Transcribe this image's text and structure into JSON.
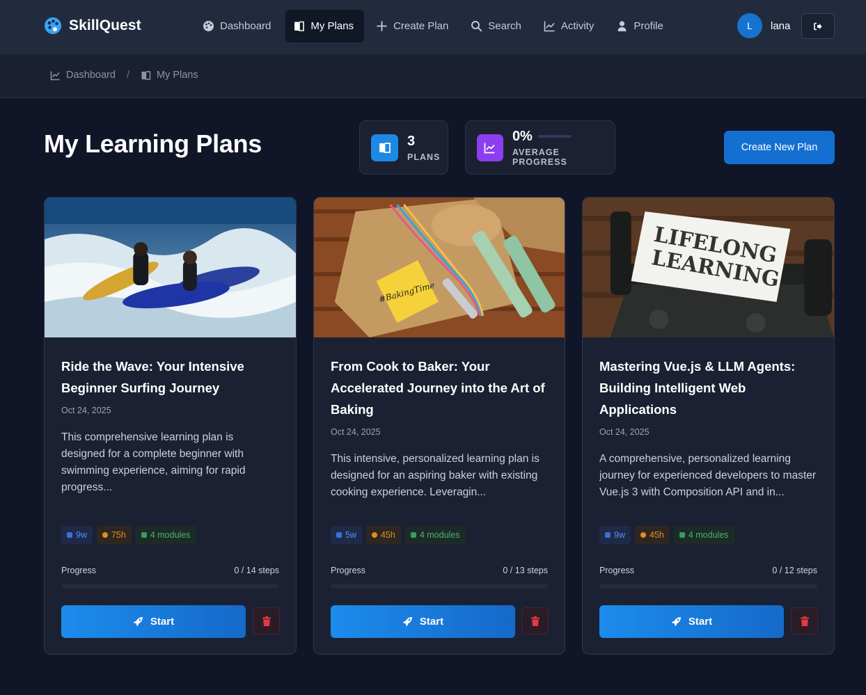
{
  "app": {
    "name": "SkillQuest"
  },
  "nav": {
    "items": [
      {
        "label": "Dashboard",
        "icon": "palette-icon",
        "active": false
      },
      {
        "label": "My Plans",
        "icon": "book-icon",
        "active": true
      },
      {
        "label": "Create Plan",
        "icon": "plus-icon",
        "active": false
      },
      {
        "label": "Search",
        "icon": "search-icon",
        "active": false
      },
      {
        "label": "Activity",
        "icon": "chart-line-icon",
        "active": false
      },
      {
        "label": "Profile",
        "icon": "user-icon",
        "active": false
      }
    ]
  },
  "user": {
    "initial": "L",
    "name": "lana"
  },
  "breadcrumb": {
    "items": [
      "Dashboard",
      "My Plans"
    ],
    "separator": "/"
  },
  "page": {
    "title": "My Learning Plans"
  },
  "stats": {
    "plans": {
      "value": "3",
      "label": "PLANS"
    },
    "progress": {
      "value": "0%",
      "label": "AVERAGE PROGRESS",
      "fraction": 0
    }
  },
  "actions": {
    "create_label": "Create New Plan"
  },
  "cards": [
    {
      "image": "surfers-in-waves",
      "title": "Ride the Wave: Your Intensive Beginner Surfing Journey",
      "date": "Oct 24, 2025",
      "description": "This comprehensive learning plan is designed for a complete beginner with swimming experience, aiming for rapid progress...",
      "tags": {
        "weeks": "9w",
        "hours": "75h",
        "modules": "4 modules"
      },
      "progress_label": "Progress",
      "progress_steps": "0 / 14 steps",
      "progress_fraction": 0,
      "start_label": "Start"
    },
    {
      "image": "baking-tools-on-cutting-board",
      "title": "From Cook to Baker: Your Accelerated Journey into the Art of Baking",
      "date": "Oct 24, 2025",
      "description": "This intensive, personalized learning plan is designed for an aspiring baker with existing cooking experience. Leveragin...",
      "tags": {
        "weeks": "5w",
        "hours": "45h",
        "modules": "4 modules"
      },
      "progress_label": "Progress",
      "progress_steps": "0 / 13 steps",
      "progress_fraction": 0,
      "start_label": "Start"
    },
    {
      "image": "typewriter-lifelong-learning",
      "title": "Mastering Vue.js & LLM Agents: Building Intelligent Web Applications",
      "date": "Oct 24, 2025",
      "description": "A comprehensive, personalized learning journey for experienced developers to master Vue.js 3 with Composition API and in...",
      "tags": {
        "weeks": "9w",
        "hours": "45h",
        "modules": "4 modules"
      },
      "progress_label": "Progress",
      "progress_steps": "0 / 12 steps",
      "progress_fraction": 0,
      "start_label": "Start"
    }
  ],
  "image_text": {
    "sticky_note": "#BakingTime",
    "paper_line1": "LIFELONG",
    "paper_line2": "LEARNING"
  },
  "colors": {
    "background": "#111528",
    "topbar": "#222b3d",
    "accent": "#1470d0",
    "plans_icon": "#1e88e5",
    "progress_icon": "#8b3ff0",
    "danger": "#e53945"
  }
}
